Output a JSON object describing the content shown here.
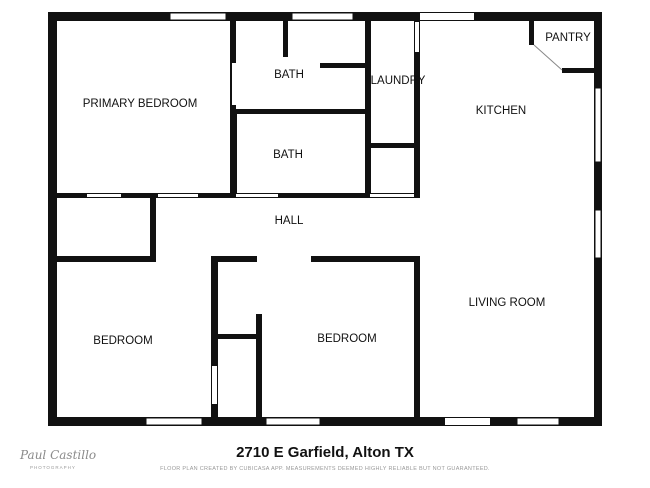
{
  "rooms": {
    "primary_bedroom": "PRIMARY BEDROOM",
    "bath_top": "BATH",
    "laundry": "LAUNDRY",
    "pantry": "PANTRY",
    "kitchen": "KITCHEN",
    "bath_mid": "BATH",
    "hall": "HALL",
    "living_room": "LIVING ROOM",
    "bedroom_left": "BEDROOM",
    "bedroom_mid": "BEDROOM"
  },
  "footer": {
    "address": "2710 E Garfield, Alton TX",
    "disclaimer": "FLOOR PLAN CREATED BY CUBICASA APP. MEASUREMENTS DEEMED HIGHLY RELIABLE BUT NOT GUARANTEED.",
    "logo_name": "Paul Castillo",
    "logo_sub": "PHOTOGRAPHY"
  },
  "colors": {
    "wall": "#111111",
    "window": "#ffffff",
    "background": "#ffffff"
  }
}
